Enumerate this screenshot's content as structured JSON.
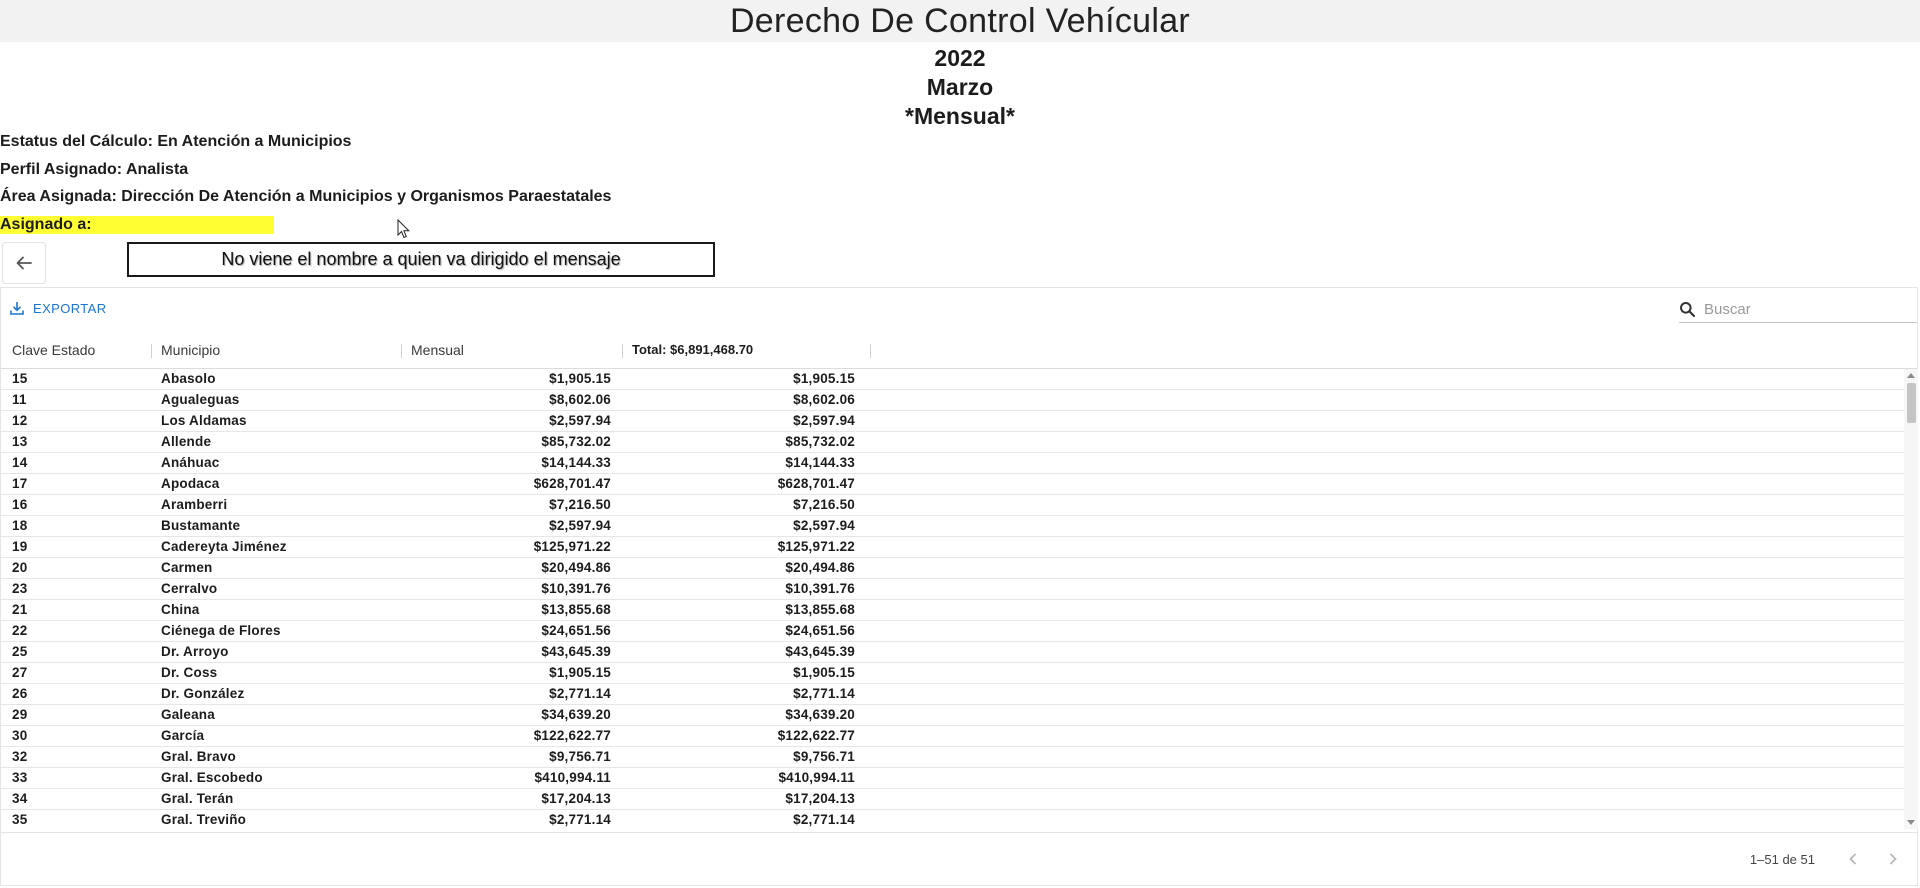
{
  "page": {
    "title": "Derecho De Control Vehícular",
    "year": "2022",
    "month": "Marzo",
    "period": "*Mensual*"
  },
  "info": {
    "estatus": "Estatus del Cálculo: En Atención a Municipios",
    "perfil": "Perfil Asignado: Analista",
    "area": "Área Asignada: Dirección De Atención a Municipios y Organismos Paraestatales",
    "asignado": "Asignado a:"
  },
  "message": "No viene el nombre a quien va dirigido el mensaje",
  "toolbar": {
    "export_label": "EXPORTAR",
    "search_placeholder": "Buscar"
  },
  "table": {
    "columns": [
      "Clave Estado",
      "Municipio",
      "Mensual",
      "Total: $6,891,468.70"
    ],
    "rows": [
      [
        "15",
        "Abasolo",
        "$1,905.15",
        "$1,905.15"
      ],
      [
        "11",
        "Agualeguas",
        "$8,602.06",
        "$8,602.06"
      ],
      [
        "12",
        "Los Aldamas",
        "$2,597.94",
        "$2,597.94"
      ],
      [
        "13",
        "Allende",
        "$85,732.02",
        "$85,732.02"
      ],
      [
        "14",
        "Anáhuac",
        "$14,144.33",
        "$14,144.33"
      ],
      [
        "17",
        "Apodaca",
        "$628,701.47",
        "$628,701.47"
      ],
      [
        "16",
        "Aramberri",
        "$7,216.50",
        "$7,216.50"
      ],
      [
        "18",
        "Bustamante",
        "$2,597.94",
        "$2,597.94"
      ],
      [
        "19",
        "Cadereyta Jiménez",
        "$125,971.22",
        "$125,971.22"
      ],
      [
        "20",
        "Carmen",
        "$20,494.86",
        "$20,494.86"
      ],
      [
        "23",
        "Cerralvo",
        "$10,391.76",
        "$10,391.76"
      ],
      [
        "21",
        "China",
        "$13,855.68",
        "$13,855.68"
      ],
      [
        "22",
        "Ciénega de Flores",
        "$24,651.56",
        "$24,651.56"
      ],
      [
        "25",
        "Dr. Arroyo",
        "$43,645.39",
        "$43,645.39"
      ],
      [
        "27",
        "Dr. Coss",
        "$1,905.15",
        "$1,905.15"
      ],
      [
        "26",
        "Dr. González",
        "$2,771.14",
        "$2,771.14"
      ],
      [
        "29",
        "Galeana",
        "$34,639.20",
        "$34,639.20"
      ],
      [
        "30",
        "García",
        "$122,622.77",
        "$122,622.77"
      ],
      [
        "32",
        "Gral. Bravo",
        "$9,756.71",
        "$9,756.71"
      ],
      [
        "33",
        "Gral. Escobedo",
        "$410,994.11",
        "$410,994.11"
      ],
      [
        "34",
        "Gral. Terán",
        "$17,204.13",
        "$17,204.13"
      ],
      [
        "35",
        "Gral. Treviño",
        "$2,771.14",
        "$2,771.14"
      ]
    ]
  },
  "pagination": {
    "text": "1–51 de 51"
  },
  "colors": {
    "accent": "#1976d2",
    "highlight": "#ffff33",
    "title_bar": "#f2f2f2"
  }
}
